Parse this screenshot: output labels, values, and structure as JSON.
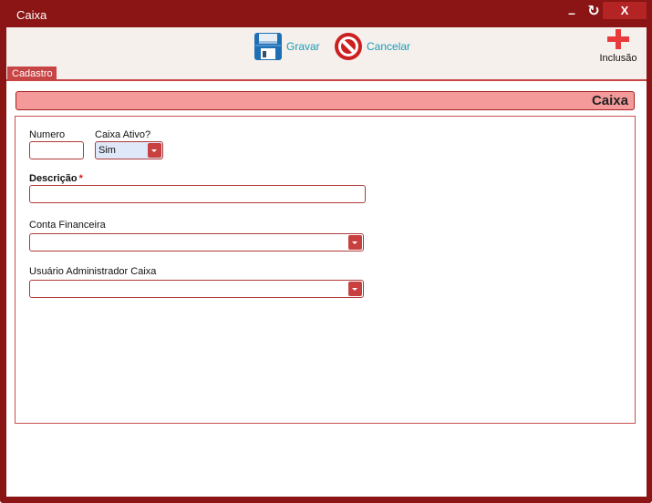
{
  "window": {
    "title": "Caixa",
    "minimize_label": "–",
    "restore_label": "↻",
    "close_label": "X"
  },
  "toolbar": {
    "save_label": "Gravar",
    "cancel_label": "Cancelar",
    "new_label": "Inclusão"
  },
  "tabs": [
    {
      "label": "Cadastro",
      "active": true
    }
  ],
  "section": {
    "title": "Caixa"
  },
  "form": {
    "numero": {
      "label": "Numero",
      "value": ""
    },
    "caixa_ativo": {
      "label": "Caixa Ativo?",
      "value": "Sim"
    },
    "descricao": {
      "label": "Descrição",
      "required_mark": "*",
      "value": ""
    },
    "conta_financeira": {
      "label": "Conta Financeira",
      "value": ""
    },
    "usuario_admin": {
      "label": "Usuário Administrador Caixa",
      "value": ""
    }
  },
  "colors": {
    "window_frame": "#8b1414",
    "accent": "#c84545",
    "section_header_bg": "#f49a9a",
    "toolbar_link": "#1a9bb6"
  },
  "icons": {
    "save": "floppy-disk-icon",
    "cancel": "no-entry-icon",
    "new": "plus-icon",
    "dropdown": "chevron-down-icon"
  }
}
